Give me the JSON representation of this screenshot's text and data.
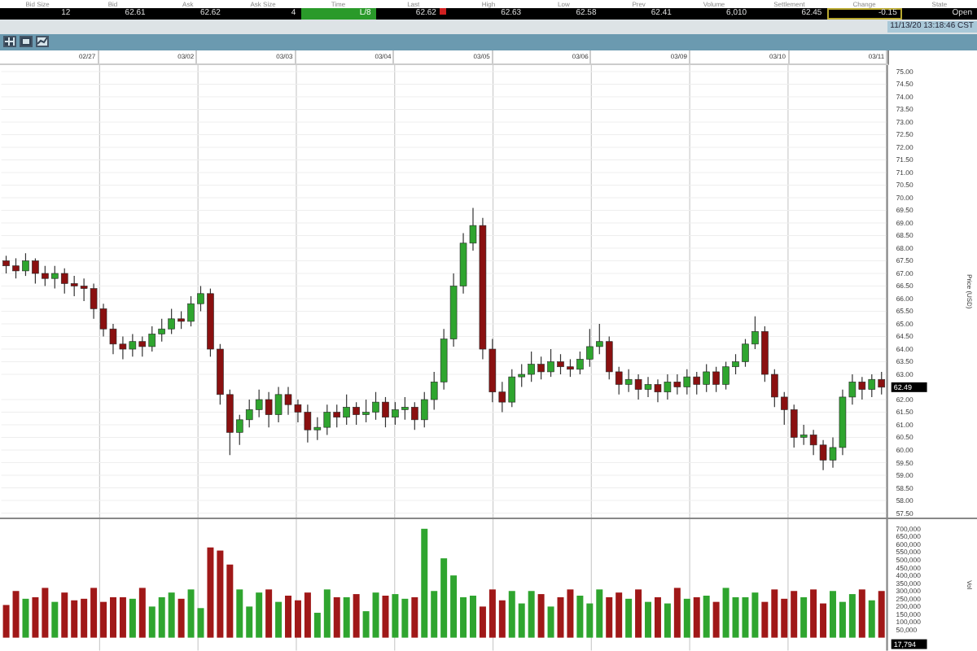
{
  "quote": [
    {
      "label": "Bid Size",
      "value": "12",
      "kind": "plain"
    },
    {
      "label": "Bid",
      "value": "62.61",
      "kind": "plain"
    },
    {
      "label": "Ask",
      "value": "62.62",
      "kind": "plain"
    },
    {
      "label": "Ask Size",
      "value": "4",
      "kind": "plain"
    },
    {
      "label": "Time",
      "value": "L/8",
      "kind": "green"
    },
    {
      "label": "Last",
      "value": "62.62",
      "kind": "down"
    },
    {
      "label": "High",
      "value": "62.63",
      "kind": "plain"
    },
    {
      "label": "Low",
      "value": "62.58",
      "kind": "plain"
    },
    {
      "label": "Prev",
      "value": "62.41",
      "kind": "plain"
    },
    {
      "label": "Volume",
      "value": "6,010",
      "kind": "plain"
    },
    {
      "label": "Settlement",
      "value": "62.45",
      "kind": "plain"
    },
    {
      "label": "Change",
      "value": "-0.15",
      "kind": "outlined"
    },
    {
      "label": "State",
      "value": "Open",
      "kind": "plain"
    }
  ],
  "timestamp": "11/13/20 13:18:46 CST",
  "time_labels": [
    "02/27",
    "03/02",
    "03/03",
    "03/04",
    "03/05",
    "03/06",
    "03/09",
    "03/10",
    "03/11"
  ],
  "price_chart": {
    "axis_title": "Price (USD)",
    "last_price": "62.49",
    "chart_data": {
      "type": "candlestick",
      "ylim": [
        57.5,
        75
      ],
      "yticks": [
        {
          "value": 75,
          "label": "75.00"
        },
        {
          "value": 74.5,
          "label": "74.50"
        },
        {
          "value": 74,
          "label": "74.00"
        },
        {
          "value": 73.5,
          "label": "73.50"
        },
        {
          "value": 73,
          "label": "73.00"
        },
        {
          "value": 72.5,
          "label": "72.50"
        },
        {
          "value": 72,
          "label": "72.00"
        },
        {
          "value": 71.5,
          "label": "71.50"
        },
        {
          "value": 71,
          "label": "71.00"
        },
        {
          "value": 70.5,
          "label": "70.50"
        },
        {
          "value": 70,
          "label": "70.00"
        },
        {
          "value": 69.5,
          "label": "69.50"
        },
        {
          "value": 69,
          "label": "69.00"
        },
        {
          "value": 68.5,
          "label": "68.50"
        },
        {
          "value": 68,
          "label": "68.00"
        },
        {
          "value": 67.5,
          "label": "67.50"
        },
        {
          "value": 67,
          "label": "67.00"
        },
        {
          "value": 66.5,
          "label": "66.50"
        },
        {
          "value": 66,
          "label": "66.00"
        },
        {
          "value": 65.5,
          "label": "65.50"
        },
        {
          "value": 65,
          "label": "65.00"
        },
        {
          "value": 64.5,
          "label": "64.50"
        },
        {
          "value": 64,
          "label": "64.00"
        },
        {
          "value": 63.5,
          "label": "63.50"
        },
        {
          "value": 63,
          "label": "63.00"
        },
        {
          "value": 62,
          "label": "62.00"
        },
        {
          "value": 61.5,
          "label": "61.50"
        },
        {
          "value": 61,
          "label": "61.00"
        },
        {
          "value": 60.5,
          "label": "60.50"
        },
        {
          "value": 60,
          "label": "60.00"
        },
        {
          "value": 59.5,
          "label": "59.50"
        },
        {
          "value": 59,
          "label": "59.00"
        },
        {
          "value": 58.5,
          "label": "58.50"
        },
        {
          "value": 58,
          "label": "58.00"
        },
        {
          "value": 57.5,
          "label": "57.50"
        }
      ],
      "grid": true,
      "ohlc": [
        [
          67.5,
          67.7,
          67.0,
          67.3
        ],
        [
          67.3,
          67.6,
          66.8,
          67.1
        ],
        [
          67.1,
          67.8,
          66.9,
          67.5
        ],
        [
          67.5,
          67.6,
          66.6,
          67.0
        ],
        [
          67.0,
          67.3,
          66.5,
          66.8
        ],
        [
          66.8,
          67.3,
          66.4,
          67.0
        ],
        [
          67.0,
          67.2,
          66.2,
          66.6
        ],
        [
          66.6,
          66.9,
          66.1,
          66.5
        ],
        [
          66.5,
          66.8,
          65.9,
          66.4
        ],
        [
          66.4,
          66.6,
          65.2,
          65.6
        ],
        [
          65.6,
          65.8,
          64.5,
          64.8
        ],
        [
          64.8,
          65.0,
          63.8,
          64.2
        ],
        [
          64.2,
          64.5,
          63.6,
          64.0
        ],
        [
          64.0,
          64.6,
          63.7,
          64.3
        ],
        [
          64.3,
          64.5,
          63.7,
          64.1
        ],
        [
          64.1,
          64.9,
          63.9,
          64.6
        ],
        [
          64.6,
          65.2,
          64.3,
          64.8
        ],
        [
          64.8,
          65.6,
          64.6,
          65.2
        ],
        [
          65.2,
          65.5,
          64.8,
          65.1
        ],
        [
          65.1,
          66.1,
          64.9,
          65.8
        ],
        [
          65.8,
          66.5,
          65.5,
          66.2
        ],
        [
          66.2,
          66.4,
          63.7,
          64.0
        ],
        [
          64.0,
          64.2,
          61.8,
          62.2
        ],
        [
          62.2,
          62.4,
          59.8,
          60.7
        ],
        [
          60.7,
          61.4,
          60.2,
          61.2
        ],
        [
          61.2,
          62.0,
          60.9,
          61.6
        ],
        [
          61.6,
          62.4,
          61.3,
          62.0
        ],
        [
          62.0,
          62.3,
          60.9,
          61.4
        ],
        [
          61.4,
          62.5,
          61.1,
          62.2
        ],
        [
          62.2,
          62.5,
          61.4,
          61.8
        ],
        [
          61.8,
          62.0,
          61.1,
          61.5
        ],
        [
          61.5,
          61.8,
          60.3,
          60.8
        ],
        [
          60.8,
          61.3,
          60.4,
          60.9
        ],
        [
          60.9,
          61.8,
          60.6,
          61.5
        ],
        [
          61.5,
          61.8,
          60.9,
          61.3
        ],
        [
          61.3,
          62.2,
          61.0,
          61.7
        ],
        [
          61.7,
          61.9,
          61.0,
          61.4
        ],
        [
          61.4,
          62.0,
          61.1,
          61.5
        ],
        [
          61.5,
          62.3,
          61.2,
          61.9
        ],
        [
          61.9,
          62.1,
          60.9,
          61.3
        ],
        [
          61.3,
          61.9,
          61.0,
          61.6
        ],
        [
          61.6,
          62.1,
          61.2,
          61.7
        ],
        [
          61.7,
          61.9,
          60.8,
          61.2
        ],
        [
          61.2,
          62.3,
          60.9,
          62.0
        ],
        [
          62.0,
          63.1,
          61.6,
          62.7
        ],
        [
          62.7,
          64.8,
          62.4,
          64.4
        ],
        [
          64.4,
          67.0,
          64.1,
          66.5
        ],
        [
          66.5,
          68.6,
          66.2,
          68.2
        ],
        [
          68.2,
          69.6,
          67.9,
          68.9
        ],
        [
          68.9,
          69.2,
          63.6,
          64.0
        ],
        [
          64.0,
          64.4,
          61.9,
          62.3
        ],
        [
          62.3,
          62.7,
          61.5,
          61.9
        ],
        [
          61.9,
          63.2,
          61.7,
          62.9
        ],
        [
          62.9,
          63.4,
          62.5,
          63.0
        ],
        [
          63.0,
          63.9,
          62.7,
          63.4
        ],
        [
          63.4,
          63.7,
          62.8,
          63.1
        ],
        [
          63.1,
          64.0,
          62.9,
          63.5
        ],
        [
          63.5,
          63.8,
          63.0,
          63.3
        ],
        [
          63.3,
          63.6,
          62.9,
          63.2
        ],
        [
          63.2,
          63.9,
          63.0,
          63.6
        ],
        [
          63.6,
          64.8,
          63.3,
          64.1
        ],
        [
          64.1,
          65.0,
          63.8,
          64.3
        ],
        [
          64.3,
          64.5,
          62.8,
          63.1
        ],
        [
          63.1,
          63.3,
          62.2,
          62.6
        ],
        [
          62.6,
          63.2,
          62.3,
          62.8
        ],
        [
          62.8,
          63.0,
          62.0,
          62.4
        ],
        [
          62.4,
          62.9,
          62.1,
          62.6
        ],
        [
          62.6,
          62.8,
          61.9,
          62.3
        ],
        [
          62.3,
          63.0,
          62.0,
          62.7
        ],
        [
          62.7,
          63.0,
          62.2,
          62.5
        ],
        [
          62.5,
          63.2,
          62.2,
          62.9
        ],
        [
          62.9,
          63.1,
          62.2,
          62.6
        ],
        [
          62.6,
          63.4,
          62.3,
          63.1
        ],
        [
          63.1,
          63.3,
          62.3,
          62.6
        ],
        [
          62.6,
          63.5,
          62.4,
          63.3
        ],
        [
          63.3,
          63.8,
          63.0,
          63.5
        ],
        [
          63.5,
          64.4,
          63.3,
          64.2
        ],
        [
          64.2,
          65.3,
          64.0,
          64.7
        ],
        [
          64.7,
          64.9,
          62.7,
          63.0
        ],
        [
          63.0,
          63.2,
          61.7,
          62.1
        ],
        [
          62.1,
          62.3,
          61.0,
          61.6
        ],
        [
          61.6,
          61.8,
          60.1,
          60.5
        ],
        [
          60.5,
          61.0,
          60.2,
          60.6
        ],
        [
          60.6,
          60.8,
          59.8,
          60.2
        ],
        [
          60.2,
          60.4,
          59.2,
          59.6
        ],
        [
          59.6,
          60.5,
          59.3,
          60.1
        ],
        [
          60.1,
          62.4,
          59.8,
          62.1
        ],
        [
          62.1,
          63.0,
          61.8,
          62.7
        ],
        [
          62.7,
          62.9,
          62.0,
          62.4
        ],
        [
          62.4,
          63.0,
          62.1,
          62.8
        ],
        [
          62.8,
          63.1,
          62.2,
          62.49
        ]
      ]
    }
  },
  "volume_chart": {
    "axis_title": "Vol",
    "last_volume": "17,794",
    "chart_data": {
      "type": "bar",
      "grid": true,
      "ylim": [
        0,
        720000
      ],
      "yticks": [
        {
          "value": 700000,
          "label": "700,000"
        },
        {
          "value": 650000,
          "label": "650,000"
        },
        {
          "value": 600000,
          "label": "600,000"
        },
        {
          "value": 550000,
          "label": "550,000"
        },
        {
          "value": 500000,
          "label": "500,000"
        },
        {
          "value": 450000,
          "label": "450,000"
        },
        {
          "value": 400000,
          "label": "400,000"
        },
        {
          "value": 350000,
          "label": "350,000"
        },
        {
          "value": 300000,
          "label": "300,000"
        },
        {
          "value": 250000,
          "label": "250,000"
        },
        {
          "value": 200000,
          "label": "200,000"
        },
        {
          "value": 150000,
          "label": "150,000"
        },
        {
          "value": 100000,
          "label": "100,000"
        },
        {
          "value": 50000,
          "label": "50,000"
        }
      ],
      "values": [
        210000,
        300000,
        250000,
        260000,
        320000,
        230000,
        290000,
        240000,
        250000,
        320000,
        230000,
        260000,
        260000,
        250000,
        320000,
        200000,
        260000,
        290000,
        250000,
        310000,
        190000,
        580000,
        560000,
        470000,
        310000,
        200000,
        290000,
        310000,
        230000,
        270000,
        240000,
        290000,
        160000,
        310000,
        260000,
        260000,
        280000,
        170000,
        290000,
        270000,
        280000,
        250000,
        260000,
        700000,
        300000,
        510000,
        400000,
        260000,
        270000,
        200000,
        310000,
        240000,
        300000,
        220000,
        300000,
        280000,
        200000,
        260000,
        310000,
        270000,
        220000,
        310000,
        260000,
        290000,
        250000,
        310000,
        230000,
        260000,
        220000,
        320000,
        250000,
        260000,
        270000,
        230000,
        320000,
        260000,
        260000,
        290000,
        230000,
        310000,
        250000,
        300000,
        260000,
        310000,
        220000,
        300000,
        230000,
        280000,
        310000,
        240000,
        300000
      ]
    }
  }
}
